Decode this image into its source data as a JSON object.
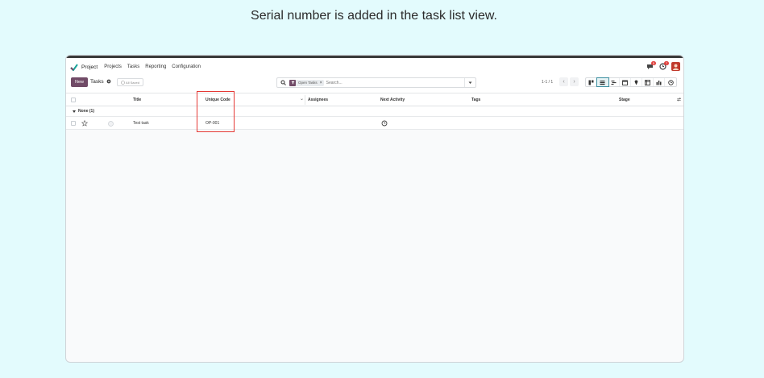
{
  "caption": "Serial number is added in the task list view.",
  "navbar": {
    "app_name": "Project",
    "menu": [
      "Projects",
      "Tasks",
      "Reporting",
      "Configuration"
    ],
    "messages_count": "5",
    "activities_count": "7"
  },
  "control_panel": {
    "new_label": "New",
    "breadcrumb": "Tasks",
    "save_indicator": "All Saved",
    "search": {
      "facet_label": "Open Tasks",
      "placeholder": "Search..."
    },
    "pager": "1-1 / 1"
  },
  "table": {
    "columns": {
      "title": "Title",
      "unique_code": "Unique Code",
      "assignees": "Assignees",
      "next_activity": "Next Activity",
      "tags": "Tags",
      "stage": "Stage"
    },
    "group": {
      "label": "None (1)"
    },
    "rows": [
      {
        "title": "Test task",
        "unique_code": "OP-001",
        "assignees": "",
        "tags": "",
        "stage": ""
      }
    ]
  },
  "colors": {
    "primary": "#714b67",
    "highlight": "#e53935",
    "background": "#e3fbfd"
  },
  "icons": {
    "app": "project-check-icon",
    "messages": "chat-icon",
    "activities": "clock-icon",
    "search": "search-icon",
    "filter": "filter-icon",
    "views": [
      "kanban-icon",
      "list-icon",
      "gantt-icon",
      "calendar-icon",
      "map-icon",
      "pivot-icon",
      "graph-icon",
      "activity-icon"
    ]
  }
}
